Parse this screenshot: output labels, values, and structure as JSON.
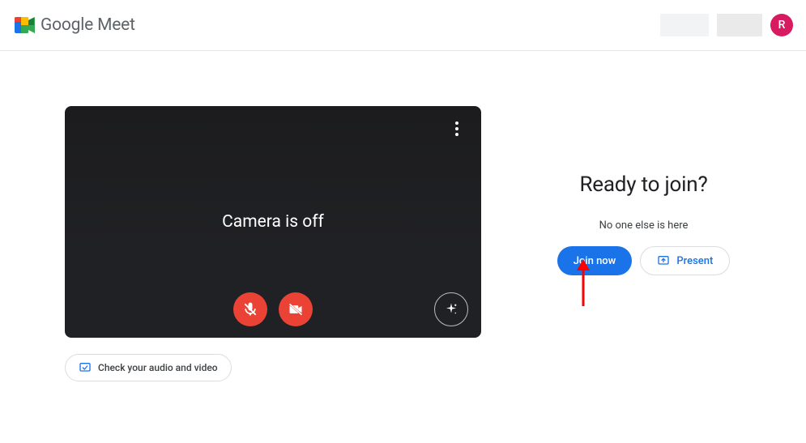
{
  "header": {
    "brand_primary": "Google",
    "brand_secondary": "Meet",
    "avatar_letter": "R"
  },
  "preview": {
    "camera_status": "Camera is off"
  },
  "check_av": {
    "label": "Check your audio and video"
  },
  "join": {
    "title": "Ready to join?",
    "participants": "No one else is here",
    "join_button": "Join now",
    "present_button": "Present"
  },
  "colors": {
    "primary_blue": "#1a73e8",
    "danger_red": "#ea4335",
    "avatar_bg": "#d81b60"
  }
}
